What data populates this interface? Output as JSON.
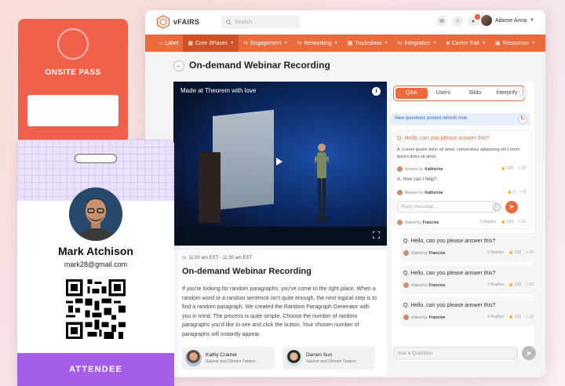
{
  "app": {
    "logo_text": "vFAIRS",
    "search_placeholder": "Search",
    "notification_count": "2",
    "user_name": "Adame Anna"
  },
  "nav": [
    {
      "label": "Label",
      "icon": "home-icon"
    },
    {
      "label": "Core SPaces",
      "icon": "grid-icon",
      "active": true
    },
    {
      "label": "Engagement",
      "icon": "engagement-icon"
    },
    {
      "label": "Networking",
      "icon": "networking-icon"
    },
    {
      "label": "Tradeshow",
      "icon": "tradeshow-icon"
    },
    {
      "label": "Integration",
      "icon": "integration-icon"
    },
    {
      "label": "Career Fair",
      "icon": "career-icon"
    },
    {
      "label": "Resources",
      "icon": "resources-icon"
    }
  ],
  "page": {
    "title": "On-demand Webinar Recording"
  },
  "video": {
    "caption": "Made at Theorem with love"
  },
  "session": {
    "time": "11:00 am EST - 11:30 am EST",
    "title": "On-demand Webinar Recording",
    "description": "If you're looking for random paragraphs, you've come to the right place. When a random word or a random sentence isn't quite enough, the next logical step is to find a random paragraph. We created the Random Paragraph Generator with you in mind. The process is quite simple. Choose the number of random paragraphs you'd like to see and click the button. Your chosen number of paragraphs will instantly appear.",
    "speakers": [
      {
        "name": "Kathy Cramer",
        "org": "Salazar and Gilmore Traders"
      },
      {
        "name": "Darren Sun",
        "org": "Salazar and Gilmore Traders"
      }
    ]
  },
  "qa": {
    "tabs": [
      "Q&A",
      "Users",
      "Slido",
      "Interprify"
    ],
    "active_tab": "Q&A",
    "notice": "New questions posted refresh now",
    "open_question": {
      "question": "Q. Hello, can you please answer this?",
      "answer1": "A. Lorem ipsum dolor sit amet, consectetur adipiscing elit Lorem ipsum dolor sit amet.",
      "answer1_by_label": "Answer by",
      "answer1_by": "Katherine",
      "answer1_likes": "123",
      "answer1_comments": "12",
      "answer2": "A. How can I help?",
      "answer2_by_label": "Answer by",
      "answer2_by": "Katherine",
      "answer2_likes": "0",
      "answer2_comments": "0",
      "reply_placeholder": "Reply message ...",
      "asked_label": "Asked by",
      "asked_by": "Francine",
      "replies": "3 Replies",
      "likes": "123",
      "comments": "12"
    },
    "questions": [
      {
        "question": "Q. Hello, can you please answer this?",
        "asked_label": "Asked by",
        "asked_by": "Francine",
        "replies": "3 Replies",
        "likes": "123",
        "comments": "12"
      },
      {
        "question": "Q. Hello, can you please answer this?",
        "asked_label": "Asked by",
        "asked_by": "Francine",
        "replies": "3 Replies",
        "likes": "123",
        "comments": "12"
      },
      {
        "question": "Q. Hello, can you please answer this?",
        "asked_label": "Asked by",
        "asked_by": "Francine",
        "replies": "3 Replies",
        "likes": "123",
        "comments": "12"
      }
    ],
    "ask_placeholder": "Ask a Question"
  },
  "pass": {
    "title": "ONSITE PASS"
  },
  "badge": {
    "name": "Mark Atchison",
    "email": "mark28@gmail.com",
    "role": "ATTENDEE"
  },
  "colors": {
    "accent": "#e96b3e",
    "pass": "#f0614b",
    "badge_role": "#a45ee8"
  }
}
